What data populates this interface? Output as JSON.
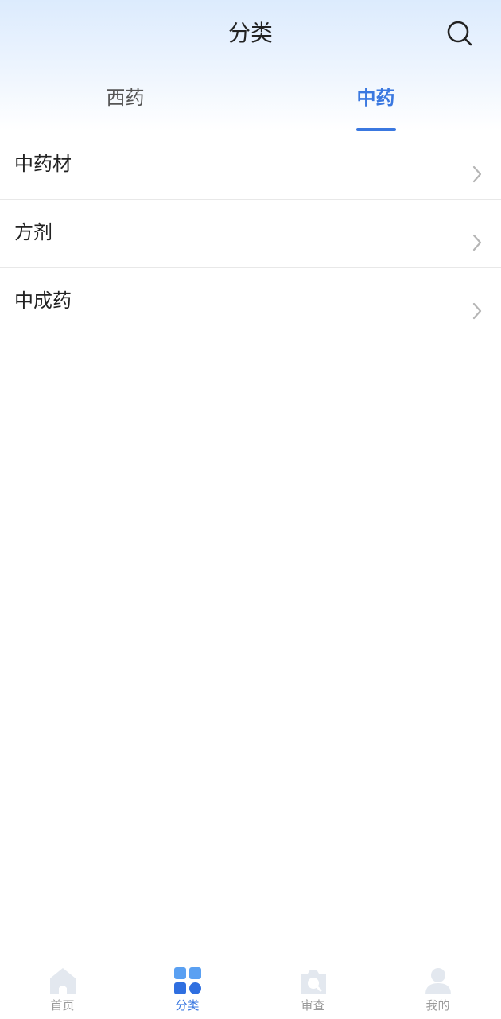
{
  "header": {
    "title": "分类",
    "search_icon": "search-icon"
  },
  "tabs": [
    {
      "label": "西药",
      "active": false
    },
    {
      "label": "中药",
      "active": true
    }
  ],
  "colors": {
    "accent": "#3a78e0",
    "inactive_text": "#9a9a9a",
    "header_gradient_top": "#dcebfd"
  },
  "list": {
    "items": [
      {
        "label": "中药材",
        "icon": "chevron-right-icon"
      },
      {
        "label": "方剂",
        "icon": "chevron-right-icon"
      },
      {
        "label": "中成药",
        "icon": "chevron-right-icon"
      }
    ]
  },
  "tabbar": {
    "items": [
      {
        "label": "首页",
        "icon": "home-icon",
        "active": false
      },
      {
        "label": "分类",
        "icon": "category-grid-icon",
        "active": true
      },
      {
        "label": "审查",
        "icon": "camera-review-icon",
        "active": false
      },
      {
        "label": "我的",
        "icon": "user-icon",
        "active": false
      }
    ]
  }
}
